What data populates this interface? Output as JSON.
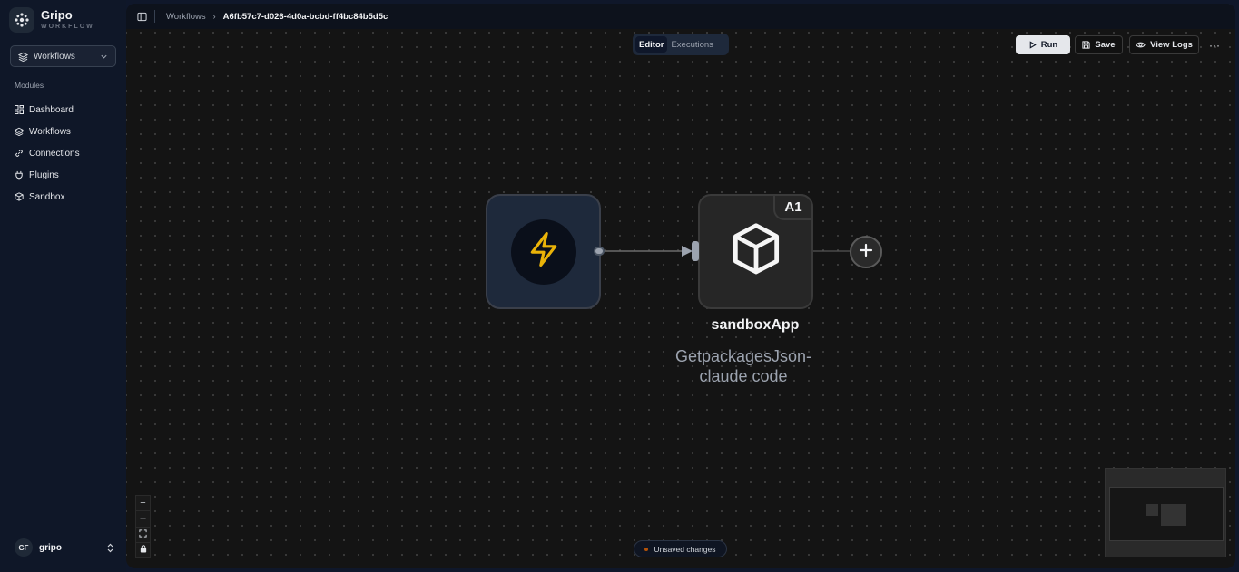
{
  "brand": {
    "name": "Gripo",
    "subtitle": "WORKFLOW"
  },
  "workspace_select": {
    "value": "Workflows"
  },
  "sidebar": {
    "modules_title": "Modules",
    "items": [
      {
        "label": "Dashboard",
        "icon": "dashboard-icon"
      },
      {
        "label": "Workflows",
        "icon": "layers-icon"
      },
      {
        "label": "Connections",
        "icon": "link-icon"
      },
      {
        "label": "Plugins",
        "icon": "plug-icon"
      },
      {
        "label": "Sandbox",
        "icon": "box-icon"
      }
    ]
  },
  "user": {
    "initials": "GF",
    "name": "gripo"
  },
  "breadcrumb": {
    "parent": "Workflows",
    "separator": "›",
    "current": "A6fb57c7-d026-4d0a-bcbd-ff4bc84b5d5c"
  },
  "tabs": [
    {
      "label": "Editor",
      "active": true
    },
    {
      "label": "Executions",
      "active": false
    }
  ],
  "toolbar": {
    "run_label": "Run",
    "save_label": "Save",
    "logs_label": "View Logs",
    "more_label": "···"
  },
  "canvas": {
    "trigger_node": {
      "icon": "lightning-icon",
      "accent": "#eab308"
    },
    "app_node": {
      "badge": "A1",
      "icon": "cube-icon",
      "title": "sandboxApp",
      "subtitle_line1": "GetpackagesJson-",
      "subtitle_line2": "claude code"
    },
    "add_node_icon": "plus-icon"
  },
  "zoom_controls": {
    "zoom_in": "+",
    "zoom_out": "–"
  },
  "status": {
    "text": "Unsaved changes",
    "dot_color": "#b45309"
  },
  "colors": {
    "sidebar_bg": "#0f1728",
    "canvas_bg": "#141414",
    "accent_run_bg": "#e5e7eb"
  }
}
